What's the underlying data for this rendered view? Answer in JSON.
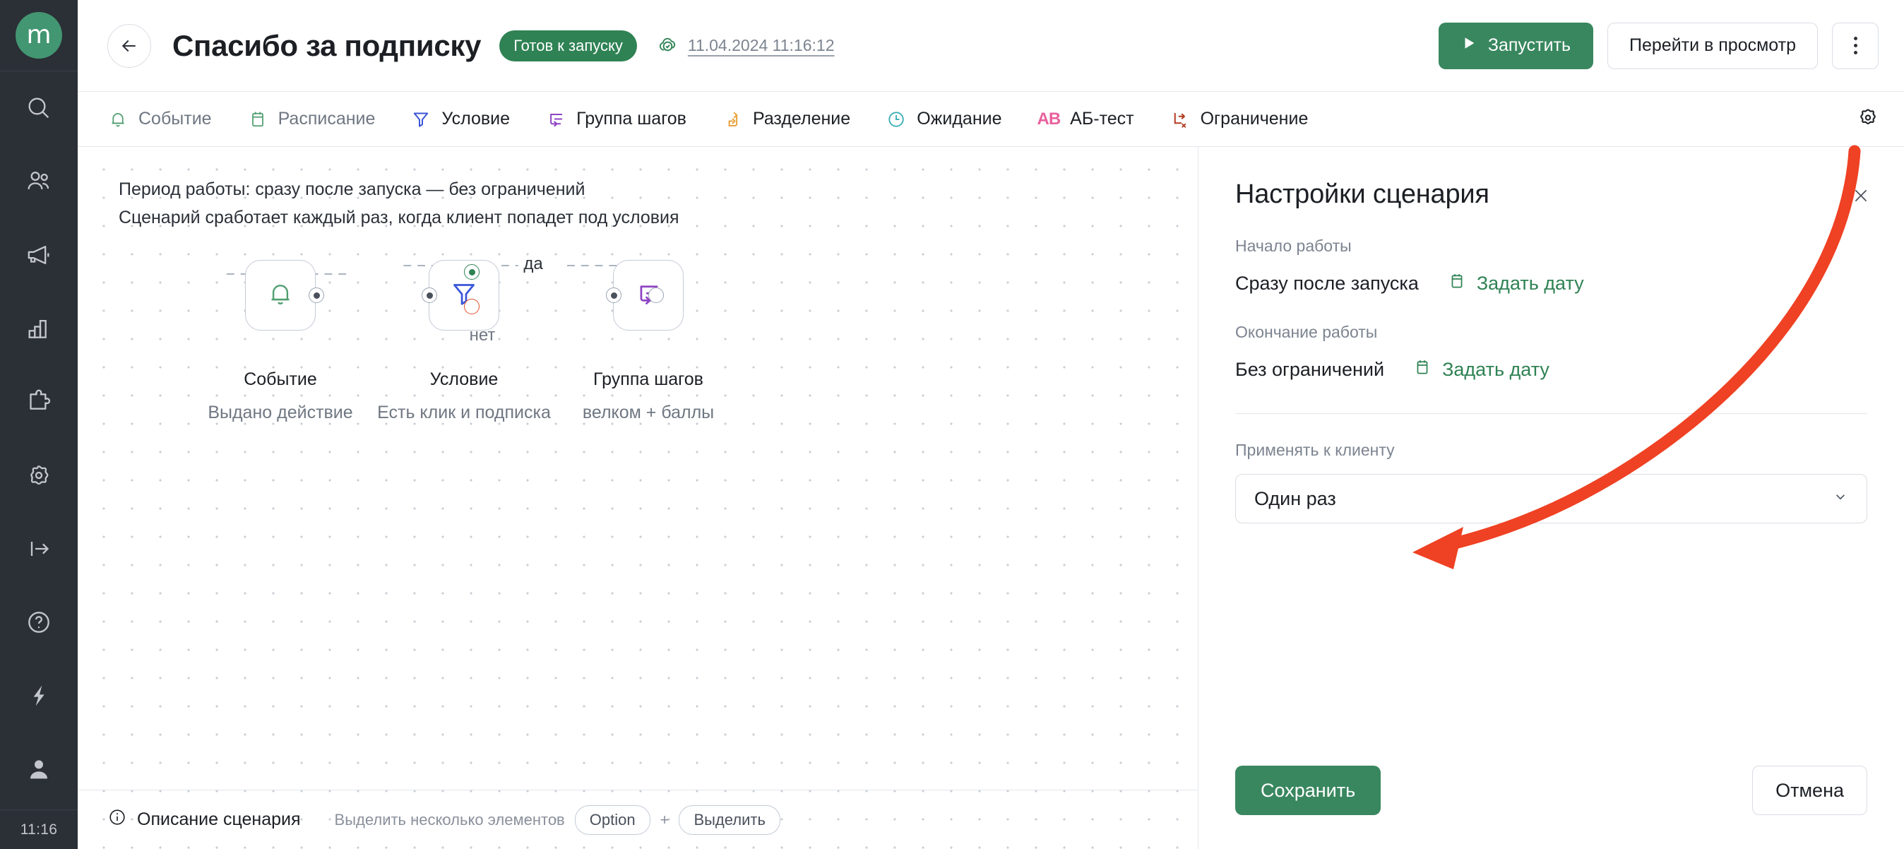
{
  "app": {
    "logo_letter": "m",
    "clock": "11:16",
    "accent_green": "#39875f",
    "status_green": "#2f8254",
    "annotation_red": "#ef4123",
    "rail_bg": "#2b2f36"
  },
  "rail": {
    "items": [
      {
        "icon": "search-icon",
        "name": "search"
      },
      {
        "icon": "users-icon",
        "name": "clients"
      },
      {
        "icon": "megaphone-icon",
        "name": "campaigns"
      },
      {
        "icon": "bar-chart-icon",
        "name": "analytics"
      },
      {
        "icon": "puzzle-icon",
        "name": "integrations"
      },
      {
        "icon": "gear-icon",
        "name": "settings"
      },
      {
        "icon": "logout-icon",
        "name": "logout"
      },
      {
        "icon": "help-icon",
        "name": "help"
      },
      {
        "icon": "lightning-icon",
        "name": "automation"
      },
      {
        "icon": "user-avatar-icon",
        "name": "profile"
      }
    ]
  },
  "header": {
    "back_label": "←",
    "title": "Спасибо за подписку",
    "status": "Готов к запуску",
    "saved_timestamp": "11.04.2024 11:16:12",
    "run_button": "Запустить",
    "preview_button": "Перейти в просмотр"
  },
  "toolbar": {
    "items": [
      {
        "label": "Событие",
        "icon": "bell-icon",
        "color": "#4f9e6f",
        "muted": true
      },
      {
        "label": "Расписание",
        "icon": "calendar-icon",
        "color": "#4f9e6f",
        "muted": true
      },
      {
        "label": "Условие",
        "icon": "filter-icon",
        "color": "#3a55d9",
        "muted": false
      },
      {
        "label": "Группа шагов",
        "icon": "steps-group-icon",
        "color": "#8e44c4",
        "muted": false
      },
      {
        "label": "Разделение",
        "icon": "split-icon",
        "color": "#e8a33d",
        "muted": false
      },
      {
        "label": "Ожидание",
        "icon": "clock-icon",
        "color": "#3aaeb5",
        "muted": false
      },
      {
        "label": "АБ-тест",
        "icon": "ab-test-icon",
        "color": "#e8619d",
        "muted": false
      },
      {
        "label": "Ограничение",
        "icon": "limit-icon",
        "color": "#b33a1e",
        "muted": false
      }
    ],
    "settings_icon": "gear-icon"
  },
  "canvas": {
    "note_line1": "Период работы: сразу после запуска — без ограничений",
    "note_line2": "Сценарий сработает каждый раз, когда клиент попадет под условия",
    "nodes": [
      {
        "id": "event",
        "icon": "bell-icon",
        "color": "#4f9e6f",
        "title": "Событие",
        "subtitle": "Выдано действие"
      },
      {
        "id": "condition",
        "icon": "filter-icon",
        "color": "#3a55d9",
        "title": "Условие",
        "subtitle": "Есть клик и подписка"
      },
      {
        "id": "steps-group",
        "icon": "steps-group-icon",
        "color": "#8e44c4",
        "title": "Группа шагов",
        "subtitle": "велком + баллы"
      }
    ],
    "edge_labels": {
      "yes": "да",
      "no": "нет"
    },
    "bottom": {
      "description": "Описание сценария",
      "hint": "Выделить несколько элементов",
      "key1": "Option",
      "plus": "+",
      "key2": "Выделить"
    }
  },
  "panel": {
    "title": "Настройки сценария",
    "close_icon": "close-icon",
    "start_label": "Начало работы",
    "start_value": "Сразу после запуска",
    "start_link": "Задать дату",
    "end_label": "Окончание работы",
    "end_value": "Без ограничений",
    "end_link": "Задать дату",
    "apply_label": "Применять к клиенту",
    "apply_value": "Один раз",
    "save_button": "Сохранить",
    "cancel_button": "Отмена"
  }
}
